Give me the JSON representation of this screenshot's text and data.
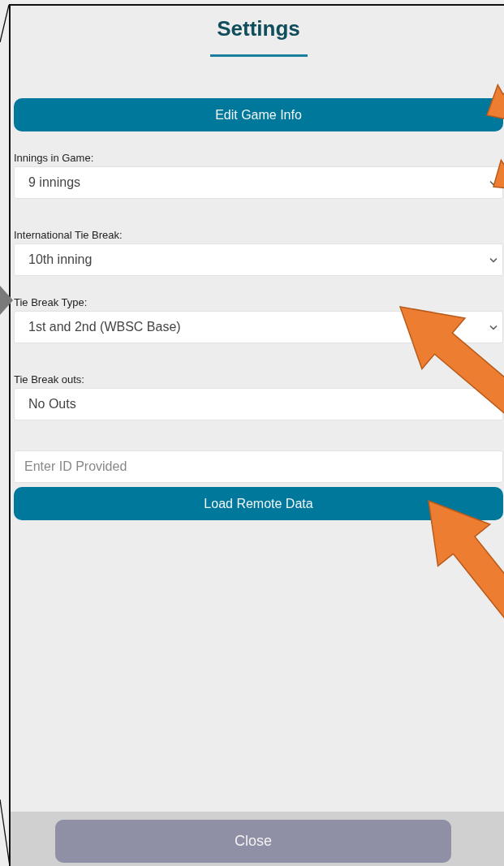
{
  "title": "Settings",
  "edit_button": "Edit Game Info",
  "fields": [
    {
      "label": "Innings in Game:",
      "value": "9 innings",
      "kind": "select"
    },
    {
      "label": "International Tie Break:",
      "value": "10th inning",
      "kind": "select"
    },
    {
      "label": "Tie Break Type:",
      "value": "1st and 2nd (WBSC Base)",
      "kind": "select"
    },
    {
      "label": "Tie Break outs:",
      "value": "No Outs",
      "kind": "plain"
    }
  ],
  "id_input": {
    "placeholder": "Enter ID Provided"
  },
  "load_button": "Load Remote Data",
  "close_button": "Close"
}
